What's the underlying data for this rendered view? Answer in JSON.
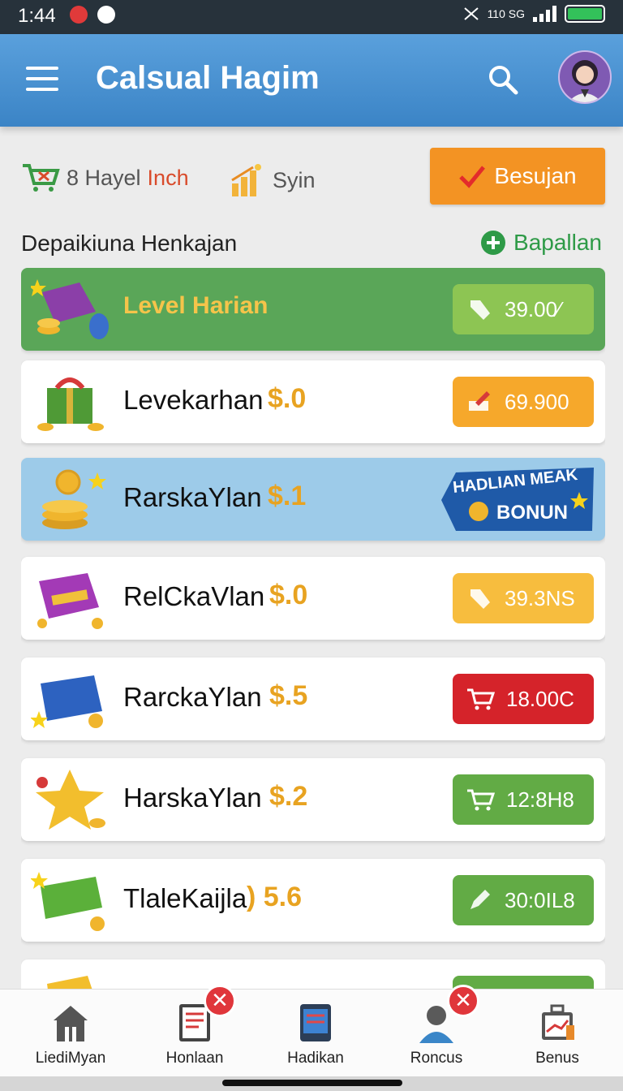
{
  "status_bar": {
    "time": "1:44",
    "network_text": "110 SG",
    "colors": {
      "bg": "#27323b",
      "battery": "#33c25a"
    }
  },
  "app_bar": {
    "title": "Calsual Hagim",
    "color": "#4a93d4"
  },
  "stats": {
    "item1_value": "8 Hayel",
    "item1_accent": "Inch",
    "item2_label": "Syin",
    "primary_button": "Besujan"
  },
  "section": {
    "title": "Depaikiuna Henkajan",
    "action": "Bapallan"
  },
  "rows": [
    {
      "name": "Level Harian",
      "amount": "",
      "badge": "39.00⁄",
      "badge_icon": "tag-icon",
      "style": "green"
    },
    {
      "name": "Levekarhan",
      "amount": "$.0",
      "badge": "69.900",
      "badge_icon": "pencil-icon",
      "style": "white"
    },
    {
      "name": "RarskaYlan",
      "amount": "$.1",
      "promo_line1": "HADLIAN MEAK",
      "promo_line2": "BONUN",
      "style": "blue"
    },
    {
      "name": "RelCkaVlan",
      "amount": "$.0",
      "badge": "39.3NS",
      "badge_icon": "tag-icon",
      "style": "white"
    },
    {
      "name": "RarckaYlan",
      "amount": "$.5",
      "badge": "18.00C",
      "badge_icon": "cart-icon",
      "style": "white"
    },
    {
      "name": "HarskaYlan",
      "amount": "$.2",
      "badge": "12:8H8",
      "badge_icon": "cart-icon",
      "style": "white"
    },
    {
      "name": "TlaleKaijla",
      "amount": ") 5.6",
      "badge": "30:0IL8",
      "badge_icon": "pencil-icon",
      "style": "white"
    }
  ],
  "bottom_nav": [
    {
      "label": "LiediMyan",
      "icon": "home-icon",
      "badge": ""
    },
    {
      "label": "Honlaan",
      "icon": "document-icon",
      "badge": "✕"
    },
    {
      "label": "Hadikan",
      "icon": "tablet-icon",
      "badge": ""
    },
    {
      "label": "Roncus",
      "icon": "profile-icon",
      "badge": "✕"
    },
    {
      "label": "Benus",
      "icon": "briefcase-icon",
      "badge": ""
    }
  ]
}
